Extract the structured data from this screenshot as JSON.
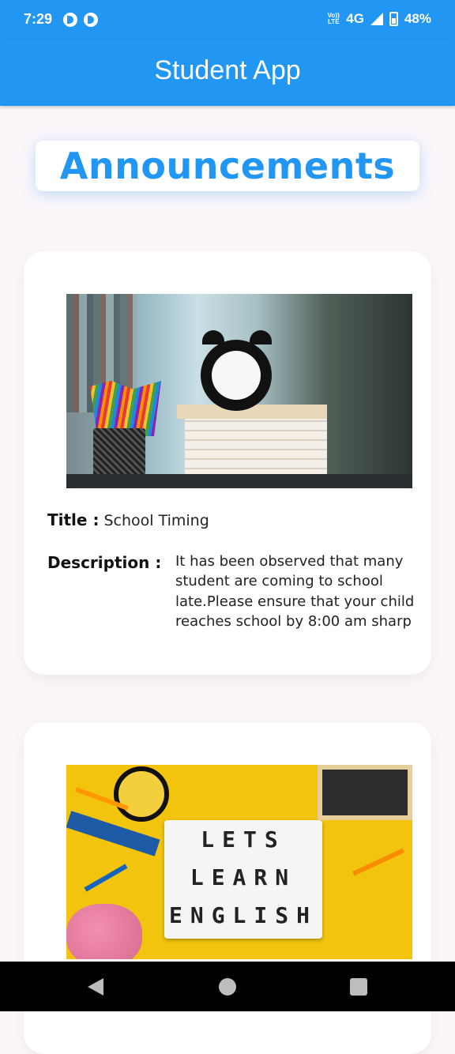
{
  "status_bar": {
    "time": "7:29",
    "volte": "Vo)) LTE",
    "network": "4G",
    "battery": "48%",
    "icons": [
      "app-notification-icon",
      "app-notification-icon",
      "volte-icon",
      "signal-icon",
      "battery-icon"
    ]
  },
  "app_bar": {
    "title": "Student App"
  },
  "page": {
    "heading": "Announcements",
    "accent_color": "#2196f3"
  },
  "announcements": [
    {
      "image_desc_icon": "school-desk-clock-image",
      "title_label": "Title :",
      "title": "School Timing",
      "description_label": "Description :",
      "description": "It has been observed that many student are coming to school late.Please ensure that your child reaches school by 8:00 am sharp"
    },
    {
      "image_desc_icon": "lets-learn-english-image",
      "image_text": [
        "LETS",
        "LEARN",
        "ENGLISH"
      ]
    }
  ],
  "nav_bar": {
    "icons": [
      "back-icon",
      "home-icon",
      "recents-icon"
    ]
  }
}
